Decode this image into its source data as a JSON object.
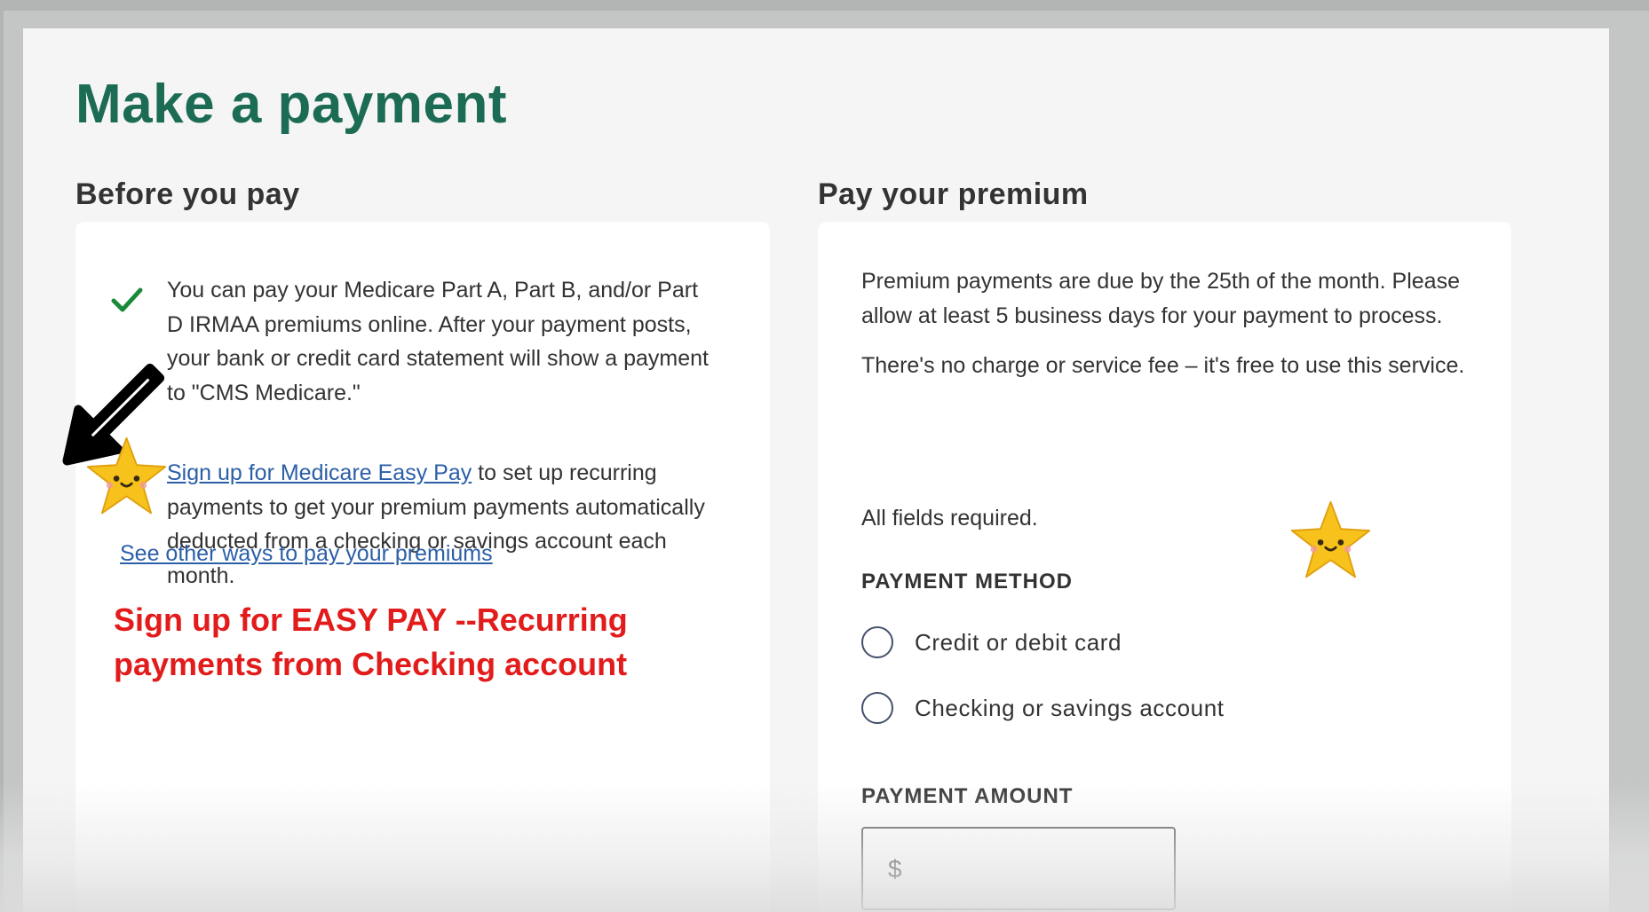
{
  "page": {
    "title": "Make a payment"
  },
  "before_you_pay": {
    "heading": "Before you pay",
    "info_text": "You can pay your Medicare Part A, Part B, and/or Part D IRMAA premiums online. After your payment posts, your bank or credit card statement will show a payment to \"CMS Medicare.\"",
    "easy_pay_link": "Sign up for Medicare Easy Pay",
    "easy_pay_rest": " to set up recurring payments to get your premium payments automatically deducted from a checking or savings account each month.",
    "other_ways_link": "See other ways to pay your premiums",
    "annotation_line1": "Sign up for EASY PAY --Recurring",
    "annotation_line2": "payments from Checking account"
  },
  "pay_premium": {
    "heading": "Pay your premium",
    "due_text": "Premium payments are due by the 25th of the month. Please allow at least 5 business days for your payment to process.",
    "fee_text": "There's no charge or service fee – it's free to use this service.",
    "required_text": "All fields required.",
    "method_label": "PAYMENT METHOD",
    "method_options": [
      "Credit or debit card",
      "Checking or savings account"
    ],
    "amount_label": "PAYMENT AMOUNT",
    "amount_prefix": "$"
  },
  "icons": {
    "check": "checkmark-icon",
    "arrow": "arrow-pointer-icon",
    "star": "star-face-icon"
  },
  "colors": {
    "title": "#1c6b54",
    "link": "#2b5fa8",
    "annotation": "#e21b1b",
    "check": "#1a8a3a",
    "star": "#f7c21b"
  }
}
